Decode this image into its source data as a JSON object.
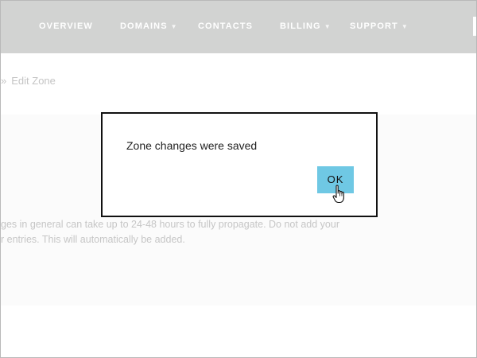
{
  "nav": {
    "items": [
      {
        "label": "OVERVIEW",
        "has_dropdown": false
      },
      {
        "label": "DOMAINS",
        "has_dropdown": true
      },
      {
        "label": "CONTACTS",
        "has_dropdown": false
      },
      {
        "label": "BILLING",
        "has_dropdown": true
      },
      {
        "label": "SUPPORT",
        "has_dropdown": true
      }
    ],
    "chevron_glyph": "▼"
  },
  "breadcrumb": {
    "separator": "»",
    "current": "Edit Zone"
  },
  "note": {
    "line1": "ges in general can take up to 24-48 hours to fully propagate. Do not add your",
    "line2": "r entries. This will automatically be added."
  },
  "dialog": {
    "message": "Zone changes were saved",
    "ok_label": "OK"
  },
  "colors": {
    "nav_bg": "#d2d3d2",
    "button_accent": "#6fc8e4",
    "dialog_border": "#111111"
  },
  "icons": {
    "pointer": "hand-pointer-icon"
  }
}
